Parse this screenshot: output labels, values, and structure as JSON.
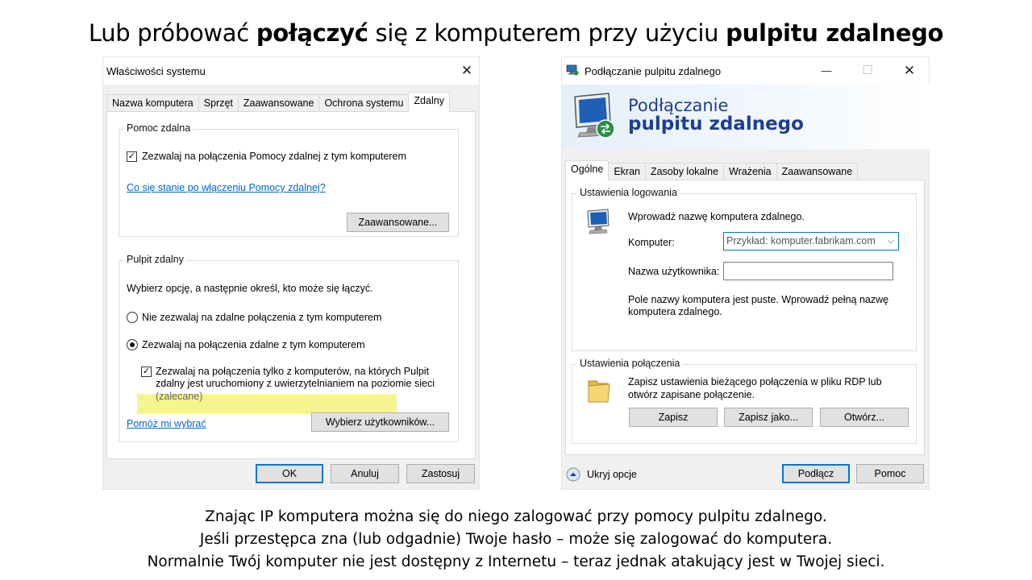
{
  "slide": {
    "title_pre": "Lub próbować ",
    "title_bold1": "połączyć",
    "title_mid": " się z komputerem przy użyciu ",
    "title_bold2": "pulpitu zdalnego",
    "footer_lines": [
      "Znając IP komputera można się do niego zalogować przy pomocy pulpitu zdalnego.",
      "Jeśli przestępca zna (lub odgadnie) Twoje hasło – może się zalogować do komputera.",
      "Normalnie Twój komputer nie jest dostępny z Internetu – teraz jednak atakujący jest w Twojej sieci."
    ]
  },
  "system_properties": {
    "window_title": "Właściwości systemu",
    "close_glyph": "✕",
    "tabs": [
      "Nazwa komputera",
      "Sprzęt",
      "Zaawansowane",
      "Ochrona systemu",
      "Zdalny"
    ],
    "selected_tab": "Zdalny",
    "remote_assistance": {
      "legend": "Pomoc zdalna",
      "checkbox_label": "Zezwalaj na połączenia Pomocy zdalnej z tym komputerem",
      "checked": true,
      "link": "Co się stanie po włączeniu Pomocy zdalnej?",
      "advanced_button": "Zaawansowane..."
    },
    "remote_desktop": {
      "legend": "Pulpit zdalny",
      "instruction": "Wybierz opcję, a następnie określ, kto może się łączyć.",
      "radio_deny": "Nie zezwalaj na zdalne połączenia z tym komputerem",
      "radio_allow": "Zezwalaj na połączenia zdalne z tym komputerem",
      "selected_option": "allow",
      "nla_line1": "Zezwalaj na połączenia tylko z komputerów, na których Pulpit",
      "nla_line2": "zdalny jest uruchomiony z uwierzytelnianiem na poziomie sieci",
      "nla_line3": "(zalecane)",
      "nla_checked": true,
      "help_link": "Pomóż mi wybrać",
      "select_users_button": "Wybierz użytkowników..."
    },
    "buttons": {
      "ok": "OK",
      "cancel": "Anuluj",
      "apply": "Zastosuj"
    },
    "check_glyph": "✓"
  },
  "rdp": {
    "window_title": "Podłączanie pulpitu zdalnego",
    "minimize_glyph": "—",
    "maximize_glyph": "☐",
    "close_glyph": "✕",
    "banner_line1": "Podłączanie",
    "banner_line2": "pulpitu zdalnego",
    "tabs": [
      "Ogólne",
      "Ekran",
      "Zasoby lokalne",
      "Wrażenia",
      "Zaawansowane"
    ],
    "selected_tab": "Ogólne",
    "logon": {
      "legend": "Ustawienia logowania",
      "instruction": "Wprowadź nazwę komputera zdalnego.",
      "computer_label": "Komputer:",
      "computer_placeholder": "Przykład: komputer.fabrikam.com",
      "chevron_glyph": "⌵",
      "username_label": "Nazwa użytkownika:",
      "username_value": "",
      "note_line1": "Pole nazwy komputera jest puste. Wprowadź pełną nazwę",
      "note_line2": "komputera zdalnego."
    },
    "connection": {
      "legend": "Ustawienia połączenia",
      "text_line1": "Zapisz ustawienia bieżącego połączenia w pliku RDP lub",
      "text_line2": "otwórz zapisane połączenie.",
      "save_button": "Zapisz",
      "save_as_button": "Zapisz jako...",
      "open_button": "Otwórz..."
    },
    "hide_options": "Ukryj opcje",
    "connect_button": "Podłącz",
    "help_button": "Pomoc"
  },
  "colors": {
    "link": "#0066cc",
    "focus_border": "#0078d7",
    "banner_text": "#1e3f8f",
    "highlight": "#f2f068"
  }
}
